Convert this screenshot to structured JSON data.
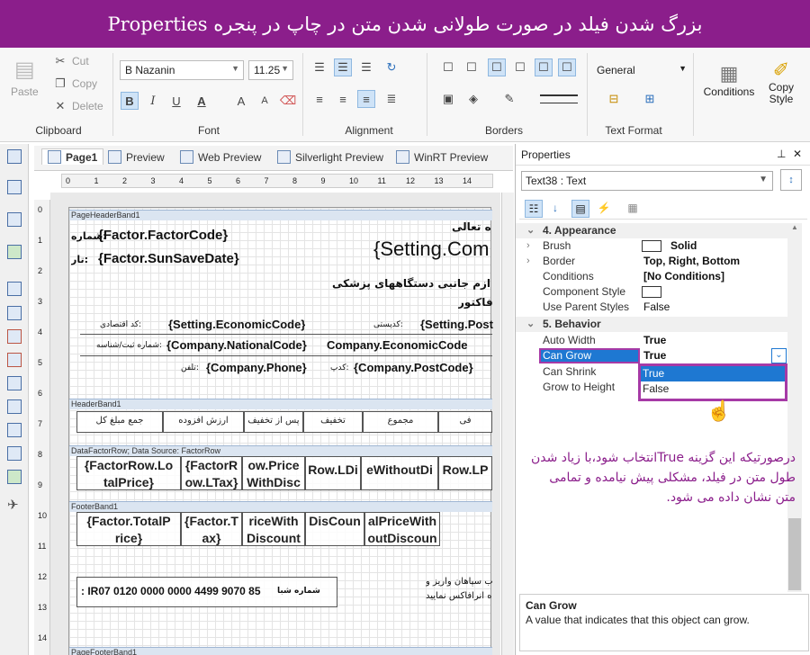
{
  "title": "بزرگ شدن فیلد در صورت طولانی شدن متن در چاپ در پنجره Properties",
  "ribbon": {
    "clipboard": {
      "paste": "Paste",
      "cut": "Cut",
      "copy": "Copy",
      "delete": "Delete",
      "label": "Clipboard"
    },
    "font": {
      "family": "B Nazanin",
      "size": "11.25",
      "bold": "B",
      "italic": "I",
      "underline": "U",
      "color_a": "A",
      "grow": "A",
      "shrink": "A",
      "label": "Font"
    },
    "alignment": {
      "label": "Alignment"
    },
    "borders": {
      "label": "Borders"
    },
    "text_format": {
      "format": "General",
      "label": "Text Format"
    },
    "conditions": "Conditions",
    "copy_style": "Copy Style"
  },
  "tabs": [
    {
      "label": "Page1",
      "active": true
    },
    {
      "label": "Preview"
    },
    {
      "label": "Web Preview"
    },
    {
      "label": "Silverlight Preview"
    },
    {
      "label": "WinRT Preview"
    }
  ],
  "ruler_h": [
    "0",
    "1",
    "2",
    "3",
    "4",
    "5",
    "6",
    "7",
    "8",
    "9",
    "10",
    "11",
    "12",
    "13",
    "14"
  ],
  "ruler_v": [
    "0",
    "1",
    "2",
    "3",
    "4",
    "5",
    "6",
    "7",
    "8",
    "9",
    "10",
    "11",
    "12",
    "13",
    "14"
  ],
  "report": {
    "page_header_band": "PageHeaderBand1",
    "factor_code": "{Factor.FactorCode}",
    "shomare": ":شماره",
    "factor_date": "{Factor.SunSaveDate}",
    "tarikh": ":تار",
    "setting_company": "{Setting.Com",
    "taali": "ه تعالی",
    "line_devices": "ازم جانبی دستگاههای پزشکی",
    "factor_word": "فاکتور",
    "economic_code": "{Setting.EconomicCode}",
    "economic_label": ":کد اقتصادی",
    "postal_label": ":کدپستی",
    "setting_post": "{Setting.Post",
    "national_code": "{Company.NationalCode}",
    "national_label": ":شماره ثبت/شناسه",
    "company_economic": "Company.EconomicCode",
    "company_phone": "{Company.Phone}",
    "phone_label": ":تلفن",
    "postal_label2": ":کدپ",
    "company_postcode": "{Company.PostCode}",
    "header_band": "HeaderBand1",
    "headers": [
      "جمع مبلغ کل",
      "ارزش افزوده",
      "پس از تخفیف",
      "تخفیف",
      "مجموع",
      "فی"
    ],
    "data_band": "DataFactorRow; Data Source: FactorRow",
    "data_cells": [
      "{FactorRow.Lo talPrice}",
      "{FactorR ow.LTax}",
      "ow.Price WithDisc",
      "Row.LDi",
      "eWithoutDi",
      "Row.LP"
    ],
    "footer_band": "FooterBand1",
    "footer_cells": [
      "{Factor.TotalP rice}",
      "{Factor.T ax}",
      "riceWith Discount",
      "DisCoun",
      "alPriceWith outDiscoun"
    ],
    "iban": ": IR07 0120 0000 0000 4499 9070 85",
    "sheba_label": "شماره شبا",
    "deposit_1": "ب سپاهان واریز و",
    "deposit_2": "ه آنرافاکس نمایید",
    "page_footer_band": "PageFooterBand1"
  },
  "properties": {
    "title": "Properties",
    "pin": "ᵖ",
    "close": "✕",
    "object": "Text38 : Text",
    "categories": [
      {
        "label": "4. Appearance",
        "rows": [
          {
            "name": "Brush",
            "value": "Solid"
          },
          {
            "name": "Border",
            "value": "Top, Right, Bottom"
          },
          {
            "name": "Conditions",
            "value": "[No Conditions]"
          },
          {
            "name": "Component Style",
            "value": ""
          },
          {
            "name": "Use Parent Styles",
            "value": "False"
          }
        ]
      },
      {
        "label": "5. Behavior",
        "rows": [
          {
            "name": "Auto Width",
            "value": "True"
          },
          {
            "name": "Can Grow",
            "value": "True"
          },
          {
            "name": "Can Shrink",
            "value": ""
          },
          {
            "name": "Grow to Height",
            "value": ""
          }
        ]
      }
    ],
    "dropdown_options": [
      "True",
      "False"
    ],
    "help_title": "Can Grow",
    "help_text": "A value that indicates that this object can grow."
  },
  "annotation": "درصورتیکه این گزینه Trueانتخاب شود،با زیاد شدن طول متن در فیلد، مشکلی پیش نیامده و تمامی متن نشان داده می شود.",
  "colors": {
    "accent": "#8b1e8b",
    "selection": "#1e78d2",
    "band": "#dbe5f1"
  }
}
